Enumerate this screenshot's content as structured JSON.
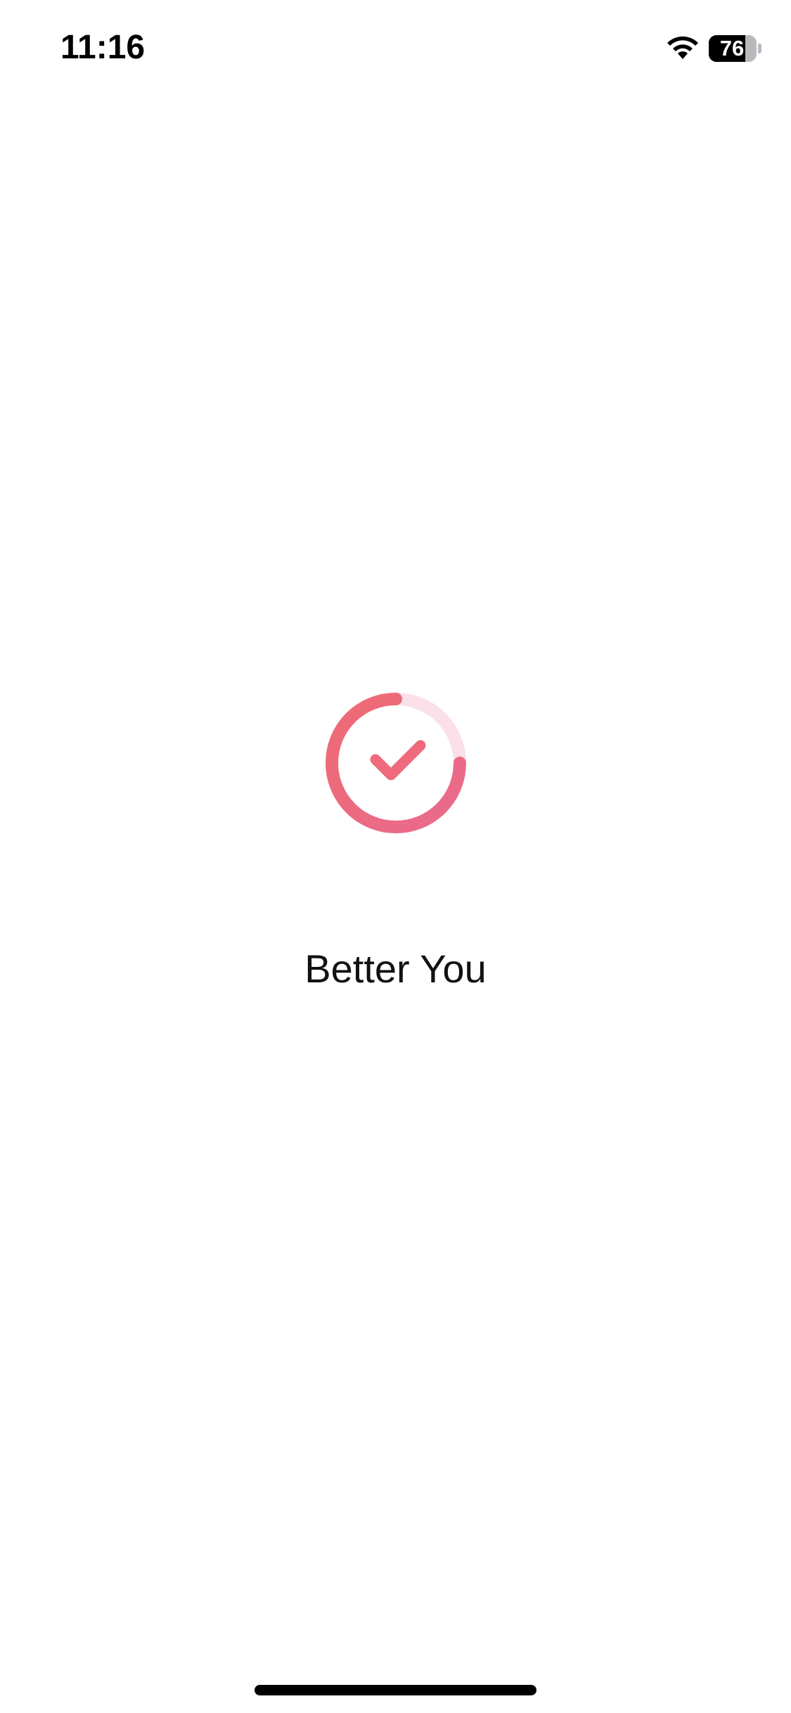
{
  "status_bar": {
    "time": "11:16",
    "battery_level": "76",
    "battery_fraction": 0.76
  },
  "icons": {
    "wifi": "wifi-icon",
    "battery": "battery-icon",
    "logo": "check-circle-logo"
  },
  "app": {
    "name": "Better You"
  },
  "colors": {
    "brand_primary": "#EE6A72",
    "brand_secondary": "#EA6A8E",
    "brand_faint": "#FBE0E8",
    "text": "#111111",
    "background": "#FFFFFF"
  }
}
